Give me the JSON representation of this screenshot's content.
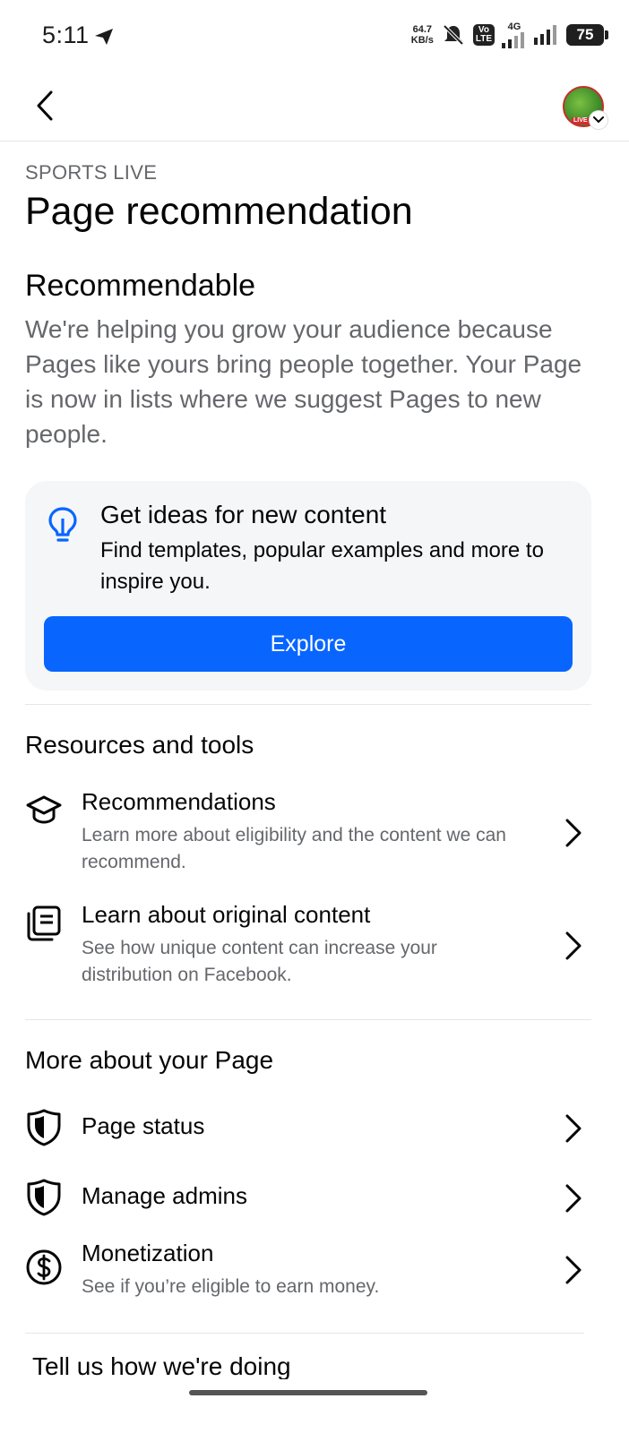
{
  "status_bar": {
    "time": "5:11",
    "net_speed_value": "64.7",
    "net_speed_unit": "KB/s",
    "volte_top": "Vo",
    "volte_bottom": "LTE",
    "network_type": "4G",
    "battery": "75",
    "icons": [
      "telegram-send-icon",
      "bell-muted-icon",
      "signal-icon",
      "battery-icon"
    ]
  },
  "nav": {
    "back_icon": "chevron-left-icon",
    "avatar_badge": "LIVE"
  },
  "header": {
    "eyebrow": "SPORTS LIVE",
    "title": "Page recommendation"
  },
  "status_section": {
    "heading": "Recommendable",
    "description": "We're helping you grow your audience because Pages like yours bring people together. Your Page is now in lists where we suggest Pages to new people."
  },
  "idea_card": {
    "icon": "lightbulb-icon",
    "title": "Get ideas for new content",
    "description": "Find templates, popular examples and more to inspire you.",
    "button_label": "Explore",
    "accent_color": "#0866ff"
  },
  "resources": {
    "heading": "Resources and tools",
    "items": [
      {
        "icon": "graduation-cap-icon",
        "title": "Recommendations",
        "subtitle": "Learn more about eligibility and the content we can recommend."
      },
      {
        "icon": "document-copy-icon",
        "title": "Learn about original content",
        "subtitle": "See how unique content can increase your distribution on Facebook."
      }
    ]
  },
  "more_about": {
    "heading": "More about your Page",
    "items": [
      {
        "icon": "shield-icon",
        "title": "Page status"
      },
      {
        "icon": "shield-icon",
        "title": "Manage admins"
      },
      {
        "icon": "dollar-circle-icon",
        "title": "Monetization",
        "subtitle": "See if you’re eligible to earn money."
      }
    ]
  },
  "feedback": {
    "heading": "Tell us how we're doing"
  }
}
